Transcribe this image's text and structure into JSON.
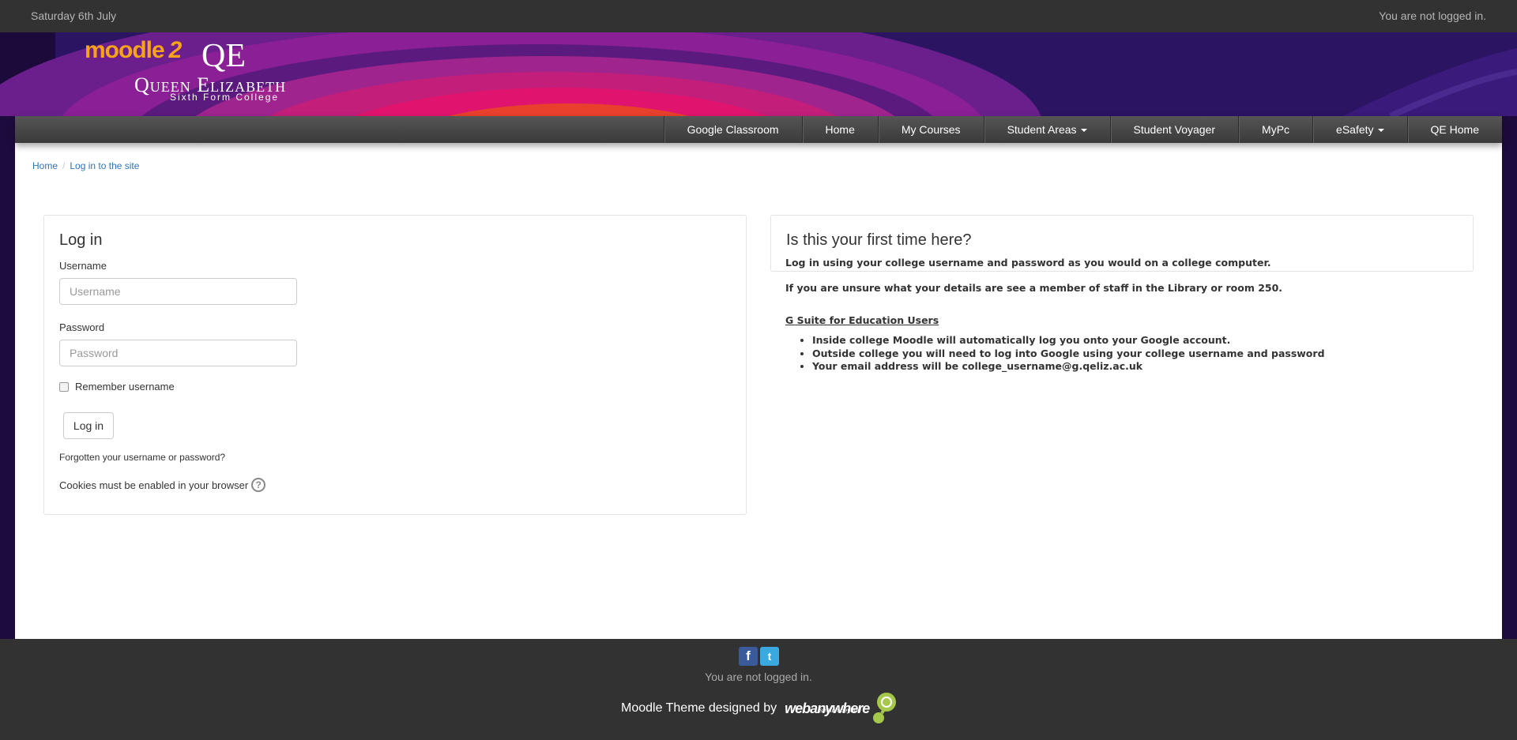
{
  "topbar": {
    "date": "Saturday 6th July",
    "login_status": "You are not logged in."
  },
  "banner": {
    "logo_moodle": "moodle",
    "logo_moodle_version": "2",
    "logo_qe": "QE",
    "logo_name": "Queen Elizabeth",
    "logo_sub": "Sixth Form College"
  },
  "nav": {
    "items": [
      {
        "label": "Google Classroom"
      },
      {
        "label": "Home"
      },
      {
        "label": "My Courses"
      },
      {
        "label": "Student Areas"
      },
      {
        "label": "Student Voyager"
      },
      {
        "label": "MyPc"
      },
      {
        "label": "eSafety"
      },
      {
        "label": "QE Home"
      }
    ]
  },
  "breadcrumb": {
    "home": "Home",
    "separator": "/",
    "current": "Log in to the site"
  },
  "login": {
    "title": "Log in",
    "username_label": "Username",
    "username_placeholder": "Username",
    "password_label": "Password",
    "password_placeholder": "Password",
    "remember_label": "Remember username",
    "button_label": "Log in",
    "forgot_link": "Forgotten your username or password?",
    "cookies_text": "Cookies must be enabled in your browser",
    "help_glyph": "?"
  },
  "info": {
    "title": "Is this your first time here?",
    "line1": "Log in using your college username and password as you would on a college computer.",
    "line2": "If you are unsure what your details are see a member of staff in the Library or room 250.",
    "gsuite_title": "G Suite for Education Users",
    "gsuite_items": [
      "Inside college  Moodle will automatically log you onto your Google account.",
      "Outside college you will need to log into Google using your college username and password",
      "Your email address will be college_username@g.qeliz.ac.uk"
    ]
  },
  "footer": {
    "facebook_glyph": "f",
    "twitter_glyph": "t",
    "login_status": "You are not logged in.",
    "credit": "Moodle Theme designed by",
    "brand": "webanywhere",
    "brand_tagline": "stretch beyond"
  },
  "colors": {
    "topbar": "#323232",
    "link": "#2c75b9",
    "nav": "#444444",
    "banner": "#2a1060"
  }
}
